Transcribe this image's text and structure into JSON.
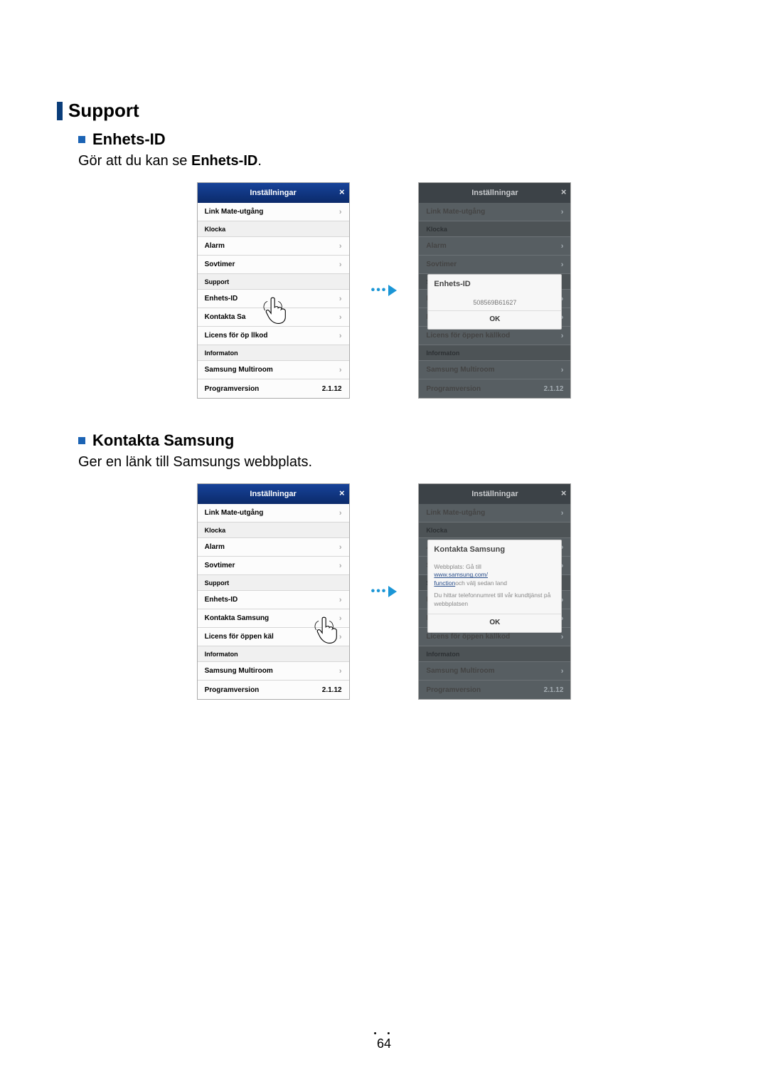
{
  "pageNumber": "64",
  "section": {
    "title": "Support"
  },
  "sub1": {
    "title": "Enhets-ID",
    "desc_prefix": "Gör att du kan se ",
    "desc_bold": "Enhets-ID",
    "desc_suffix": "."
  },
  "sub2": {
    "title": "Kontakta Samsung",
    "desc": "Ger en länk till Samsungs webbplats."
  },
  "common": {
    "header": "Inställningar",
    "close": "×",
    "linkmate": "Link Mate-utgång",
    "klocka": "Klocka",
    "alarm": "Alarm",
    "sovtimer": "Sovtimer",
    "support": "Support",
    "enhetsid": "Enhets-ID",
    "kontakta_short1": "Kontakta Sa",
    "kontakta_full": "Kontakta Samsung",
    "licens_short1": "Licens för öp          llkod",
    "licens_full": "Licens för öppen källkod",
    "licens_short2": "Licens för öppen käl",
    "informaton": "Informaton",
    "multiroom": "Samsung Multiroom",
    "programversion": "Programversion",
    "version": "2.1.12",
    "ok": "OK"
  },
  "popup_enhets": {
    "title": "Enhets-ID",
    "id": "508569B61627"
  },
  "popup_kontakta": {
    "title": "Kontakta Samsung",
    "line1": "Webbplats: Gå till",
    "link1": "www.samsung.com/",
    "link2": "function",
    "line1_suffix": "och välj sedan land",
    "line2": "Du hittar telefonnumret till vår kundtjänst på webbplatsen"
  }
}
